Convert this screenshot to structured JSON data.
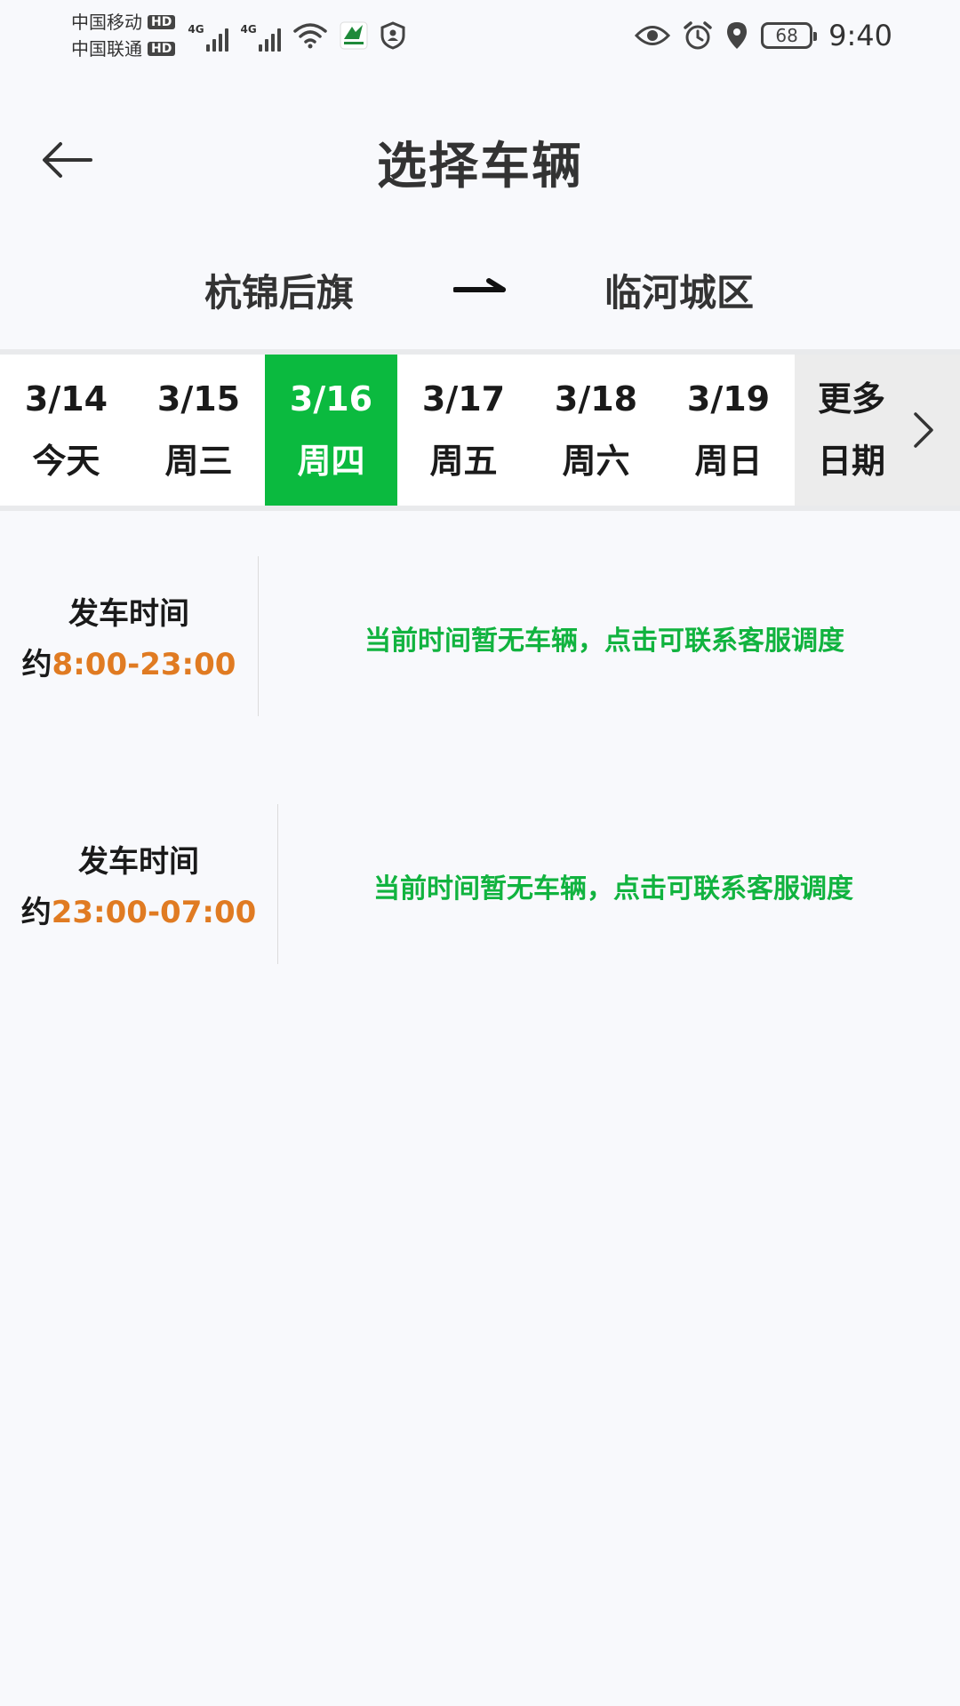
{
  "status_bar": {
    "carrier_1": "中国移动",
    "carrier_2": "中国联通",
    "hd_label": "HD",
    "network_1": "4G",
    "network_2": "4G",
    "battery_level": "68",
    "time": "9:40"
  },
  "header": {
    "title": "选择车辆"
  },
  "route": {
    "from": "杭锦后旗",
    "to": "临河城区"
  },
  "dates": {
    "items": [
      {
        "date": "3/14",
        "label": "今天"
      },
      {
        "date": "3/15",
        "label": "周三"
      },
      {
        "date": "3/16",
        "label": "周四",
        "selected": true
      },
      {
        "date": "3/17",
        "label": "周五"
      },
      {
        "date": "3/18",
        "label": "周六"
      },
      {
        "date": "3/19",
        "label": "周日"
      }
    ],
    "more_line_1": "更多",
    "more_line_2": "日期"
  },
  "schedules": [
    {
      "label": "发车时间",
      "prefix": "约",
      "range": "8:00-23:00",
      "message": "当前时间暂无车辆，点击可联系客服调度"
    },
    {
      "label": "发车时间",
      "prefix": "约",
      "range": "23:00-07:00",
      "message": "当前时间暂无车辆，点击可联系客服调度"
    }
  ],
  "colors": {
    "accent_green": "#0bba3f",
    "link_green": "#11b33f",
    "time_orange": "#e07b22",
    "background": "#f8f9fc"
  }
}
